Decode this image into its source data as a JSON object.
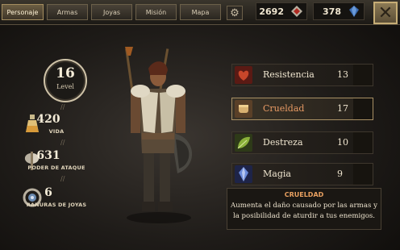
{
  "tabs": [
    {
      "label": "Personaje",
      "active": true
    },
    {
      "label": "Armas",
      "active": false
    },
    {
      "label": "Joyas",
      "active": false
    },
    {
      "label": "Misión",
      "active": false
    },
    {
      "label": "Mapa",
      "active": false
    }
  ],
  "currency": {
    "gold": "2692",
    "gems": "378"
  },
  "close_icon": "close-x-icon",
  "level": {
    "value": "16",
    "label": "Level"
  },
  "stats": [
    {
      "value": "420",
      "label": "VIDA",
      "icon": "potion-icon"
    },
    {
      "value": "631",
      "label": "PODER DE ATAQUE",
      "icon": "axe-icon"
    },
    {
      "value": "6",
      "label": "RANURAS DE JOYAS",
      "icon": "jewel-slots-icon"
    }
  ],
  "attributes": [
    {
      "name": "Resistencia",
      "value": "13",
      "icon": "heart-icon",
      "color": "#8a2a22",
      "selected": false
    },
    {
      "name": "Crueldad",
      "value": "17",
      "icon": "fist-icon",
      "color": "#9a7040",
      "selected": true
    },
    {
      "name": "Destreza",
      "value": "10",
      "icon": "leaf-icon",
      "color": "#5a7a2a",
      "selected": false
    },
    {
      "name": "Magia",
      "value": "9",
      "icon": "crystal-icon",
      "color": "#3a4a8a",
      "selected": false
    }
  ],
  "description": {
    "title": "CRUELDAD",
    "text": "Aumenta el daño causado por las armas y la posibilidad de aturdir a tus enemigos."
  },
  "colors": {
    "accent": "#e8a060",
    "gold": "#c6ad75"
  }
}
